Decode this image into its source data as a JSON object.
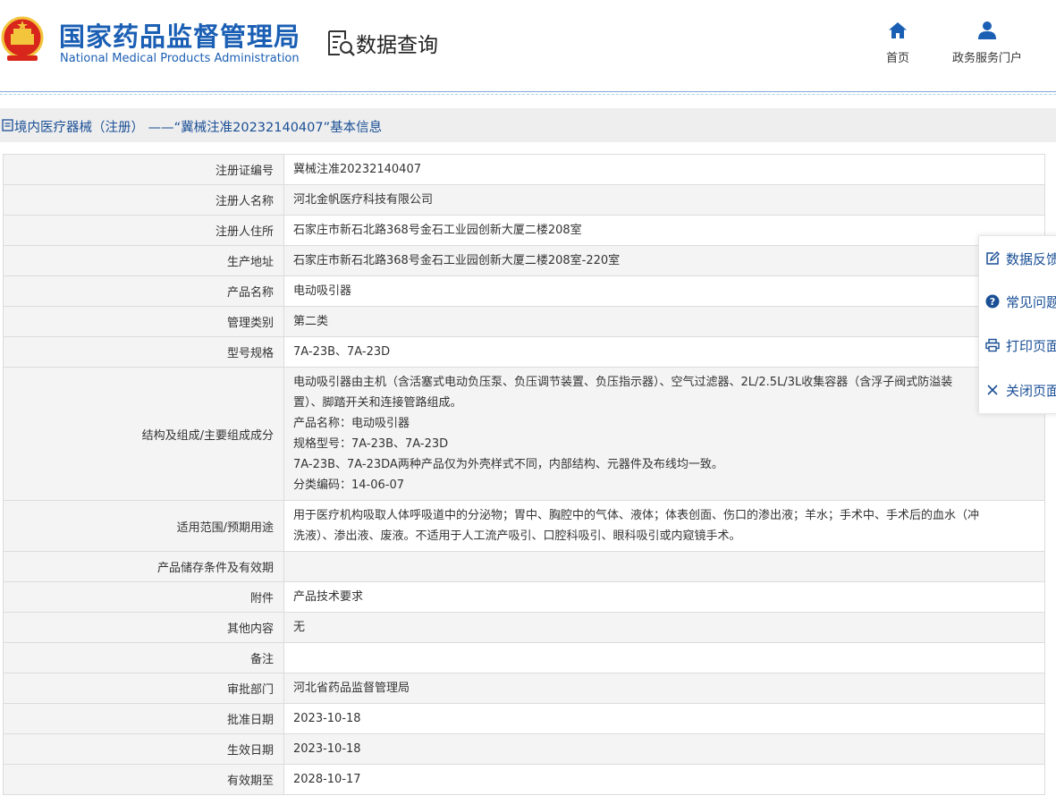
{
  "header": {
    "site_name_cn": "国家药品监督管理局",
    "site_name_en": "National Medical Products Administration",
    "section_title": "数据查询",
    "nav": [
      {
        "label": "首页",
        "icon": "home-icon"
      },
      {
        "label": "政务服务门户",
        "icon": "user-icon"
      }
    ]
  },
  "page_title": "境内医疗器械（注册） ——“冀械注准20232140407”基本信息",
  "records": [
    {
      "label": "注册证编号",
      "value": "冀械注准20232140407"
    },
    {
      "label": "注册人名称",
      "value": "河北金帆医疗科技有限公司"
    },
    {
      "label": "注册人住所",
      "value": "石家庄市新石北路368号金石工业园创新大厦二楼208室"
    },
    {
      "label": "生产地址",
      "value": "石家庄市新石北路368号金石工业园创新大厦二楼208室-220室"
    },
    {
      "label": "产品名称",
      "value": "电动吸引器"
    },
    {
      "label": "管理类别",
      "value": "第二类"
    },
    {
      "label": "型号规格",
      "value": "7A-23B、7A-23D"
    },
    {
      "label": "结构及组成/主要组成成分",
      "lines": [
        "电动吸引器由主机（含活塞式电动负压泵、负压调节装置、负压指示器）、空气过滤器、2L/2.5L/3L收集容器（含浮子阀式防溢装",
        "置）、脚踏开关和连接管路组成。",
        "产品名称：电动吸引器",
        "规格型号：7A-23B、7A-23D",
        "7A-23B、7A-23DA两种产品仅为外壳样式不同，内部结构、元器件及布线均一致。",
        "分类编码：14-06-07"
      ]
    },
    {
      "label": "适用范围/预期用途",
      "lines": [
        "用于医疗机构吸取人体呼吸道中的分泌物；胃中、胸腔中的气体、液体；体表创面、伤口的渗出液；羊水；手术中、手术后的血水（冲",
        "洗液）、渗出液、废液。不适用于人工流产吸引、口腔科吸引、眼科吸引或内窥镜手术。"
      ]
    },
    {
      "label": "产品储存条件及有效期",
      "value": ""
    },
    {
      "label": "附件",
      "value": "产品技术要求"
    },
    {
      "label": "其他内容",
      "value": "无"
    },
    {
      "label": "备注",
      "value": ""
    },
    {
      "label": "审批部门",
      "value": "河北省药品监督管理局"
    },
    {
      "label": "批准日期",
      "value": "2023-10-18"
    },
    {
      "label": "生效日期",
      "value": "2023-10-18"
    },
    {
      "label": "有效期至",
      "value": "2028-10-17"
    }
  ],
  "side_panel": [
    {
      "label": "数据反馈",
      "icon": "edit-icon"
    },
    {
      "label": "常见问题",
      "icon": "question-icon"
    },
    {
      "label": "打印页面",
      "icon": "print-icon"
    },
    {
      "label": "关闭页面",
      "icon": "close-icon"
    }
  ],
  "colors": {
    "brand_blue": "#1b5fb4",
    "label_bg": "#f4f4f4",
    "title_bar_bg": "#eeeeee",
    "link_blue": "#1a4f95",
    "emblem_red": "#d8261c",
    "emblem_gold": "#f3c53c"
  }
}
